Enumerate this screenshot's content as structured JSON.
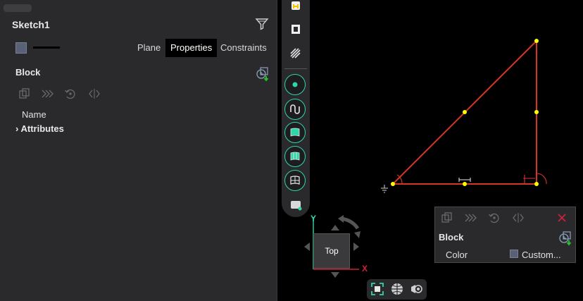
{
  "sketch": {
    "title": "Sketch1"
  },
  "tabs": [
    {
      "label": "Plane"
    },
    {
      "label": "Properties",
      "active": true
    },
    {
      "label": "Constraints"
    }
  ],
  "block": {
    "label": "Block",
    "columns": {
      "name": "Name"
    },
    "rows": [
      {
        "label": "Attributes",
        "expandable": true
      }
    ]
  },
  "view_cube": {
    "face": "Top",
    "axis_y": "Y",
    "axis_x": "X"
  },
  "popup": {
    "title": "Block",
    "property_label": "Color",
    "property_value": "Custom..."
  },
  "colors": {
    "accent": "#2fd6a8",
    "sketch_line": "#d8352a",
    "constraint_point": "#ffff00",
    "panel_bg": "#2a2a2c",
    "axis_x": "#d0203a"
  },
  "icons": {
    "toolbar": [
      "sketch-tool-icon",
      "extrude-icon",
      "hatch-icon",
      "point-icon",
      "curve-icon",
      "surface-icon",
      "loft-icon",
      "grid-surface-icon",
      "solid-body-icon"
    ],
    "view_controls": [
      "fit-view-icon",
      "shading-icon",
      "camera-icon"
    ]
  }
}
